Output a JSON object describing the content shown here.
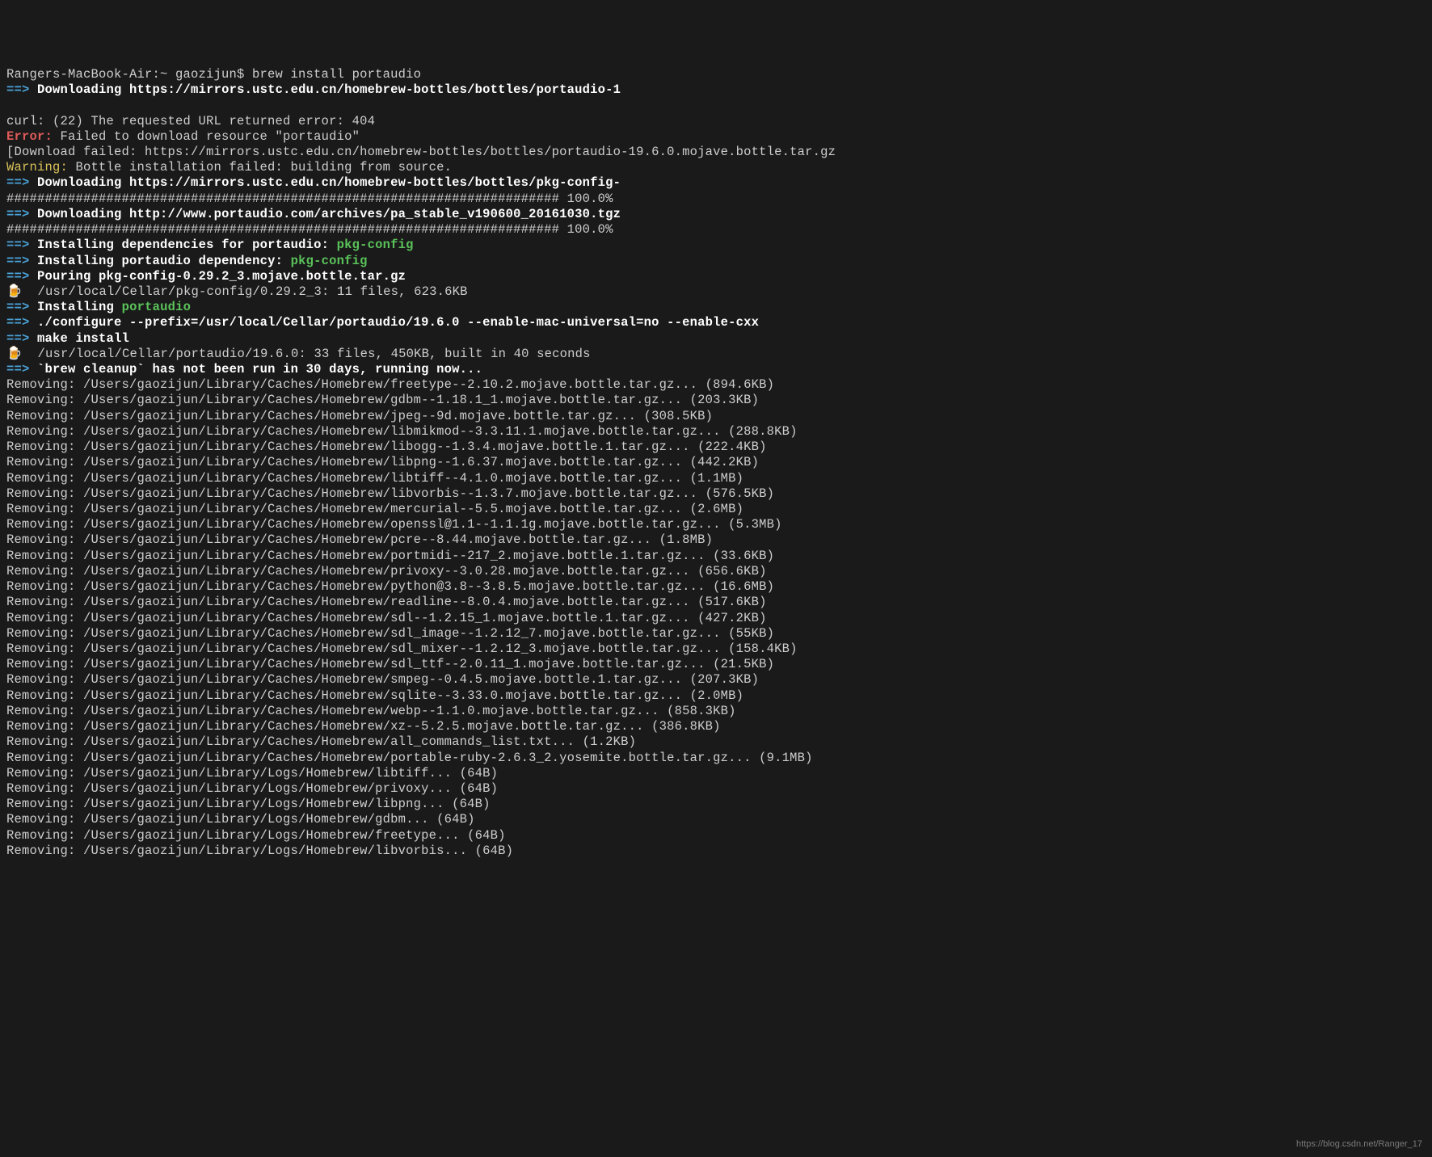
{
  "prompt": "Rangers-MacBook-Air:~ gaozijun$ brew install portaudio",
  "arrow": "==>",
  "dl1": "Downloading https://mirrors.ustc.edu.cn/homebrew-bottles/bottles/portaudio-1",
  "blank": "",
  "curl": "curl: (22) The requested URL returned error: 404",
  "error_label": "Error:",
  "error_text": " Failed to download resource \"portaudio\"",
  "dlfail": "[Download failed: https://mirrors.ustc.edu.cn/homebrew-bottles/bottles/portaudio-19.6.0.mojave.bottle.tar.gz",
  "warn_label": "Warning:",
  "warn_text": " Bottle installation failed: building from source.",
  "dl2": "Downloading https://mirrors.ustc.edu.cn/homebrew-bottles/bottles/pkg-config-",
  "bar1": "######################################################################## 100.0%",
  "dl3": "Downloading http://www.portaudio.com/archives/pa_stable_v190600_20161030.tgz",
  "bar2": "######################################################################## 100.0%",
  "dep1_a": "Installing dependencies for portaudio: ",
  "dep1_b": "pkg-config",
  "dep2_a": "Installing portaudio dependency: ",
  "dep2_b": "pkg-config",
  "pour": "Pouring pkg-config-0.29.2_3.mojave.bottle.tar.gz",
  "beer": "🍺",
  "cellar1": "  /usr/local/Cellar/pkg-config/0.29.2_3: 11 files, 623.6KB",
  "inst_a": "Installing ",
  "inst_b": "portaudio",
  "cfg": "./configure --prefix=/usr/local/Cellar/portaudio/19.6.0 --enable-mac-universal=no --enable-cxx",
  "make": "make install",
  "cellar2": "  /usr/local/Cellar/portaudio/19.6.0: 33 files, 450KB, built in 40 seconds",
  "cleanup": "`brew cleanup` has not been run in 30 days, running now...",
  "removing": [
    "Removing: /Users/gaozijun/Library/Caches/Homebrew/freetype--2.10.2.mojave.bottle.tar.gz... (894.6KB)",
    "Removing: /Users/gaozijun/Library/Caches/Homebrew/gdbm--1.18.1_1.mojave.bottle.tar.gz... (203.3KB)",
    "Removing: /Users/gaozijun/Library/Caches/Homebrew/jpeg--9d.mojave.bottle.tar.gz... (308.5KB)",
    "Removing: /Users/gaozijun/Library/Caches/Homebrew/libmikmod--3.3.11.1.mojave.bottle.tar.gz... (288.8KB)",
    "Removing: /Users/gaozijun/Library/Caches/Homebrew/libogg--1.3.4.mojave.bottle.1.tar.gz... (222.4KB)",
    "Removing: /Users/gaozijun/Library/Caches/Homebrew/libpng--1.6.37.mojave.bottle.tar.gz... (442.2KB)",
    "Removing: /Users/gaozijun/Library/Caches/Homebrew/libtiff--4.1.0.mojave.bottle.tar.gz... (1.1MB)",
    "Removing: /Users/gaozijun/Library/Caches/Homebrew/libvorbis--1.3.7.mojave.bottle.tar.gz... (576.5KB)",
    "Removing: /Users/gaozijun/Library/Caches/Homebrew/mercurial--5.5.mojave.bottle.tar.gz... (2.6MB)",
    "Removing: /Users/gaozijun/Library/Caches/Homebrew/openssl@1.1--1.1.1g.mojave.bottle.tar.gz... (5.3MB)",
    "Removing: /Users/gaozijun/Library/Caches/Homebrew/pcre--8.44.mojave.bottle.tar.gz... (1.8MB)",
    "Removing: /Users/gaozijun/Library/Caches/Homebrew/portmidi--217_2.mojave.bottle.1.tar.gz... (33.6KB)",
    "Removing: /Users/gaozijun/Library/Caches/Homebrew/privoxy--3.0.28.mojave.bottle.tar.gz... (656.6KB)",
    "Removing: /Users/gaozijun/Library/Caches/Homebrew/python@3.8--3.8.5.mojave.bottle.tar.gz... (16.6MB)",
    "Removing: /Users/gaozijun/Library/Caches/Homebrew/readline--8.0.4.mojave.bottle.tar.gz... (517.6KB)",
    "Removing: /Users/gaozijun/Library/Caches/Homebrew/sdl--1.2.15_1.mojave.bottle.1.tar.gz... (427.2KB)",
    "Removing: /Users/gaozijun/Library/Caches/Homebrew/sdl_image--1.2.12_7.mojave.bottle.tar.gz... (55KB)",
    "Removing: /Users/gaozijun/Library/Caches/Homebrew/sdl_mixer--1.2.12_3.mojave.bottle.tar.gz... (158.4KB)",
    "Removing: /Users/gaozijun/Library/Caches/Homebrew/sdl_ttf--2.0.11_1.mojave.bottle.tar.gz... (21.5KB)",
    "Removing: /Users/gaozijun/Library/Caches/Homebrew/smpeg--0.4.5.mojave.bottle.1.tar.gz... (207.3KB)",
    "Removing: /Users/gaozijun/Library/Caches/Homebrew/sqlite--3.33.0.mojave.bottle.tar.gz... (2.0MB)",
    "Removing: /Users/gaozijun/Library/Caches/Homebrew/webp--1.1.0.mojave.bottle.tar.gz... (858.3KB)",
    "Removing: /Users/gaozijun/Library/Caches/Homebrew/xz--5.2.5.mojave.bottle.tar.gz... (386.8KB)",
    "Removing: /Users/gaozijun/Library/Caches/Homebrew/all_commands_list.txt... (1.2KB)",
    "Removing: /Users/gaozijun/Library/Caches/Homebrew/portable-ruby-2.6.3_2.yosemite.bottle.tar.gz... (9.1MB)",
    "Removing: /Users/gaozijun/Library/Logs/Homebrew/libtiff... (64B)",
    "Removing: /Users/gaozijun/Library/Logs/Homebrew/privoxy... (64B)",
    "Removing: /Users/gaozijun/Library/Logs/Homebrew/libpng... (64B)",
    "Removing: /Users/gaozijun/Library/Logs/Homebrew/gdbm... (64B)",
    "Removing: /Users/gaozijun/Library/Logs/Homebrew/freetype... (64B)",
    "Removing: /Users/gaozijun/Library/Logs/Homebrew/libvorbis... (64B)"
  ],
  "watermark": "https://blog.csdn.net/Ranger_17"
}
